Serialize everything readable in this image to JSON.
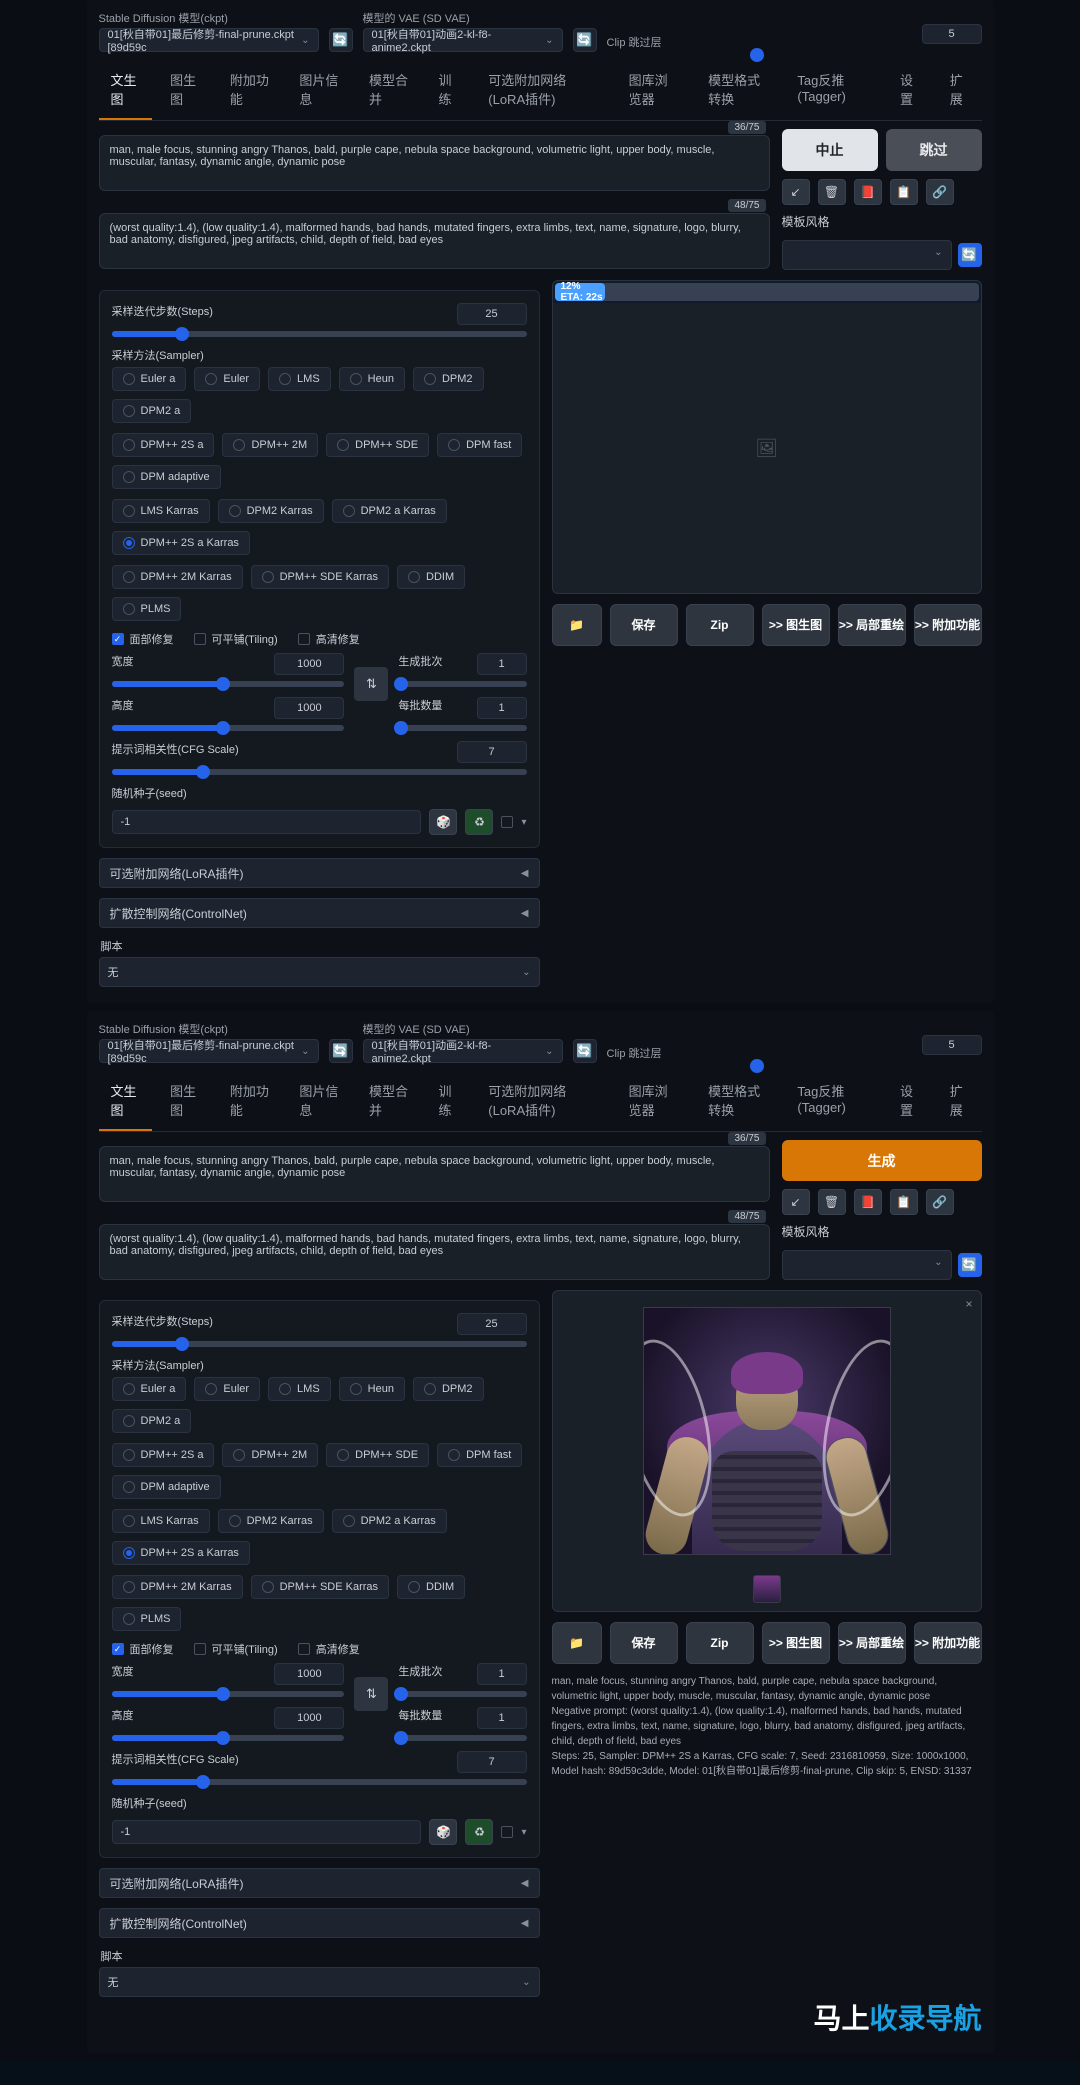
{
  "header": {
    "ckpt_label": "Stable Diffusion 模型(ckpt)",
    "ckpt_value": "01[秋自带01]最后修剪-final-prune.ckpt [89d59c",
    "vae_label": "模型的 VAE (SD VAE)",
    "vae_value": "01[秋自带01]动画2-kl-f8-anime2.ckpt",
    "clip_label": "Clip 跳过层",
    "clip_value": "5",
    "refresh": "🔄"
  },
  "tabs": [
    "文生图",
    "图生图",
    "附加功能",
    "图片信息",
    "模型合并",
    "训练",
    "可选附加网络(LoRA插件)",
    "图库浏览器",
    "模型格式转换",
    "Tag反推(Tagger)",
    "设置",
    "扩展"
  ],
  "prompt": {
    "positive": "man, male focus, stunning angry Thanos, bald, purple cape, nebula space background, volumetric light, upper body, muscle, muscular, fantasy, dynamic angle, dynamic pose",
    "pos_token": "36/75",
    "negative": "(worst quality:1.4), (low quality:1.4), malformed hands, bad hands, mutated fingers, extra limbs, text, name, signature, logo, blurry, bad anatomy, disfigured, jpeg artifacts, child, depth of field, bad eyes",
    "neg_token": "48/75"
  },
  "gen_top": {
    "interrupt": "中止",
    "skip": "跳过",
    "generate": "生成",
    "style_label": "模板风格",
    "icons": {
      "arrow": "↙",
      "trash": "🗑",
      "book": "📕",
      "paste": "📋",
      "clip": "🔗"
    },
    "cycle": "🔄"
  },
  "params": {
    "steps_label": "采样迭代步数(Steps)",
    "steps": "25",
    "sampler_label": "采样方法(Sampler)",
    "samplers_r1": [
      "Euler a",
      "Euler",
      "LMS",
      "Heun",
      "DPM2",
      "DPM2 a"
    ],
    "samplers_r2": [
      "DPM++ 2S a",
      "DPM++ 2M",
      "DPM++ SDE",
      "DPM fast",
      "DPM adaptive"
    ],
    "samplers_r3": [
      "LMS Karras",
      "DPM2 Karras",
      "DPM2 a Karras",
      "DPM++ 2S a Karras"
    ],
    "samplers_r4": [
      "DPM++ 2M Karras",
      "DPM++ SDE Karras",
      "DDIM",
      "PLMS"
    ],
    "selected_sampler": "DPM++ 2S a Karras",
    "check_face": "面部修复",
    "check_tile": "可平铺(Tiling)",
    "check_hires": "高清修复",
    "width_label": "宽度",
    "width": "1000",
    "height_label": "高度",
    "height": "1000",
    "swap": "⇅",
    "batch_count_label": "生成批次",
    "batch_count": "1",
    "batch_size_label": "每批数量",
    "batch_size": "1",
    "cfg_label": "提示词相关性(CFG Scale)",
    "cfg": "7",
    "seed_label": "随机种子(seed)",
    "seed": "-1",
    "dice": "🎲",
    "recycle": "♻",
    "lora_label": "可选附加网络(LoRA插件)",
    "cnet_label": "扩散控制网络(ControlNet)",
    "script_label": "脚本",
    "script_value": "无"
  },
  "preview": {
    "progress": "12% ETA: 22s",
    "placeholder": "🖼",
    "close": "×"
  },
  "actions": {
    "folder": "📁",
    "save": "保存",
    "zip": "Zip",
    "to_img2img": ">> 图生图",
    "to_inpaint": ">> 局部重绘",
    "to_extras": ">> 附加功能"
  },
  "info": {
    "l1": "man, male focus, stunning angry Thanos, bald, purple cape, nebula space background, volumetric light, upper body, muscle, muscular, fantasy, dynamic angle, dynamic pose",
    "l2": "Negative prompt: (worst quality:1.4), (low quality:1.4), malformed hands, bad hands, mutated fingers, extra limbs, text, name, signature, logo, blurry, bad anatomy, disfigured, jpeg artifacts, child, depth of field, bad eyes",
    "l3": "Steps: 25, Sampler: DPM++ 2S a Karras, CFG scale: 7, Seed: 2316810959, Size: 1000x1000, Model hash: 89d59c3dde, Model: 01[秋自带01]最后修剪-final-prune, Clip skip: 5, ENSD: 31337"
  },
  "watermark": {
    "a": "马上",
    "b": "收录导航"
  }
}
